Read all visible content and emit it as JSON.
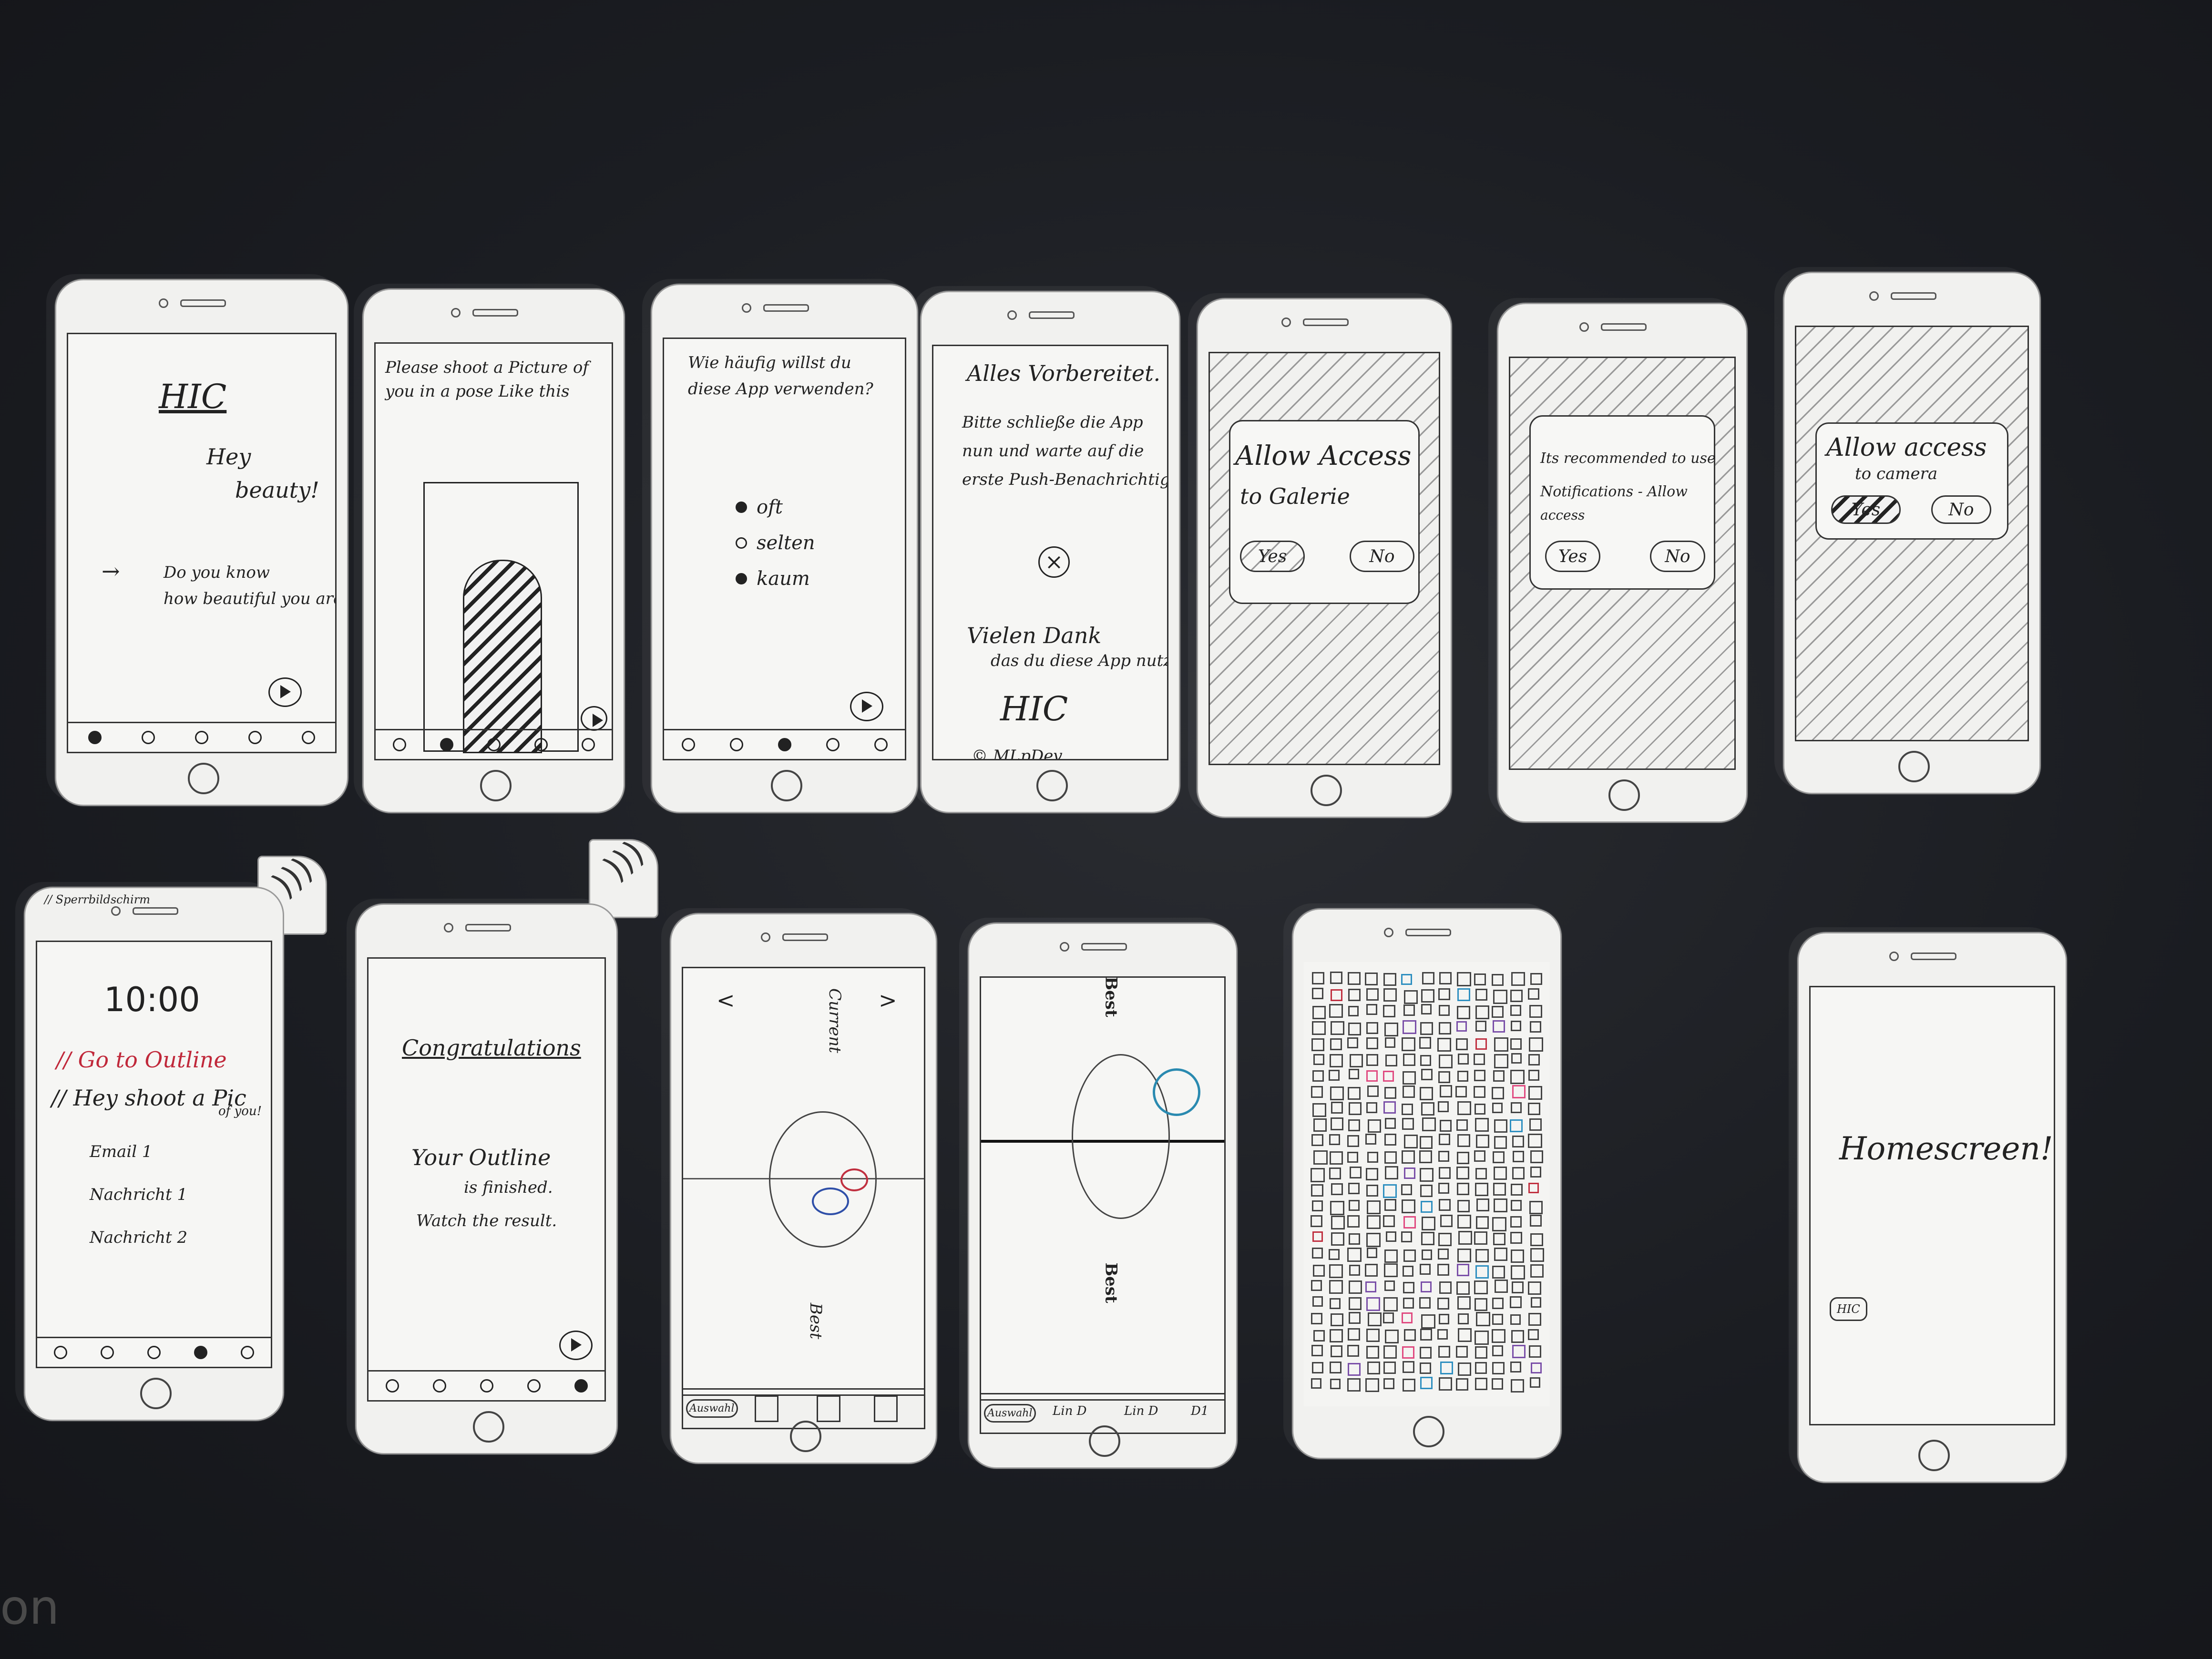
{
  "screens": {
    "s1": {
      "logo": "HIC",
      "line1": "Hey",
      "line2": "beauty!",
      "q1": "Do you know",
      "q2": "how beautiful you are?"
    },
    "s2": {
      "line1": "Please shoot a Picture of",
      "line2": "you in a pose Like this"
    },
    "s3": {
      "q1": "Wie häufig willst du",
      "q2": "diese App verwenden?",
      "options": [
        "oft",
        "selten",
        "kaum"
      ]
    },
    "s4": {
      "title": "Alles Vorbereitet.",
      "l1": "Bitte schließe die App",
      "l2": "nun und warte auf die",
      "l3": "erste Push-Benachrichtigung",
      "thanks": "Vielen Dank",
      "thanks2": "das du diese App nutzt",
      "logo": "HIC",
      "copyright": "© MLpDev"
    },
    "s5": {
      "l1": "Allow Access",
      "l2": "to Galerie",
      "yes": "Yes",
      "no": "No"
    },
    "s6": {
      "l1": "Its recommended to use",
      "l2": "Notifications - Allow",
      "l3": "access",
      "yes": "Yes",
      "no": "No"
    },
    "s7": {
      "l1": "Allow access",
      "l2": "to camera",
      "yes": "Yes",
      "no": "No"
    },
    "s8": {
      "status": "// Sperrbildschirm",
      "time": "10:00",
      "n1": "// Go to Outline",
      "n2": "// Hey shoot a Pic",
      "n2b": "of you!",
      "i1": "Email 1",
      "i2": "Nachricht 1",
      "i3": "Nachricht 2"
    },
    "s9": {
      "title": "Congratulations",
      "l1": "Your Outline",
      "l2": "is finished.",
      "l3": "Watch the result."
    },
    "s10": {
      "top": "Current",
      "bottom": "Best",
      "btn": "Auswahl"
    },
    "s11": {
      "top": "Best",
      "bottom": "Best",
      "btn": "Auswahl",
      "items": [
        "Lin D",
        "Lin D",
        "D1"
      ]
    },
    "s13": {
      "text": "Homescreen!",
      "badge": "HIC"
    }
  },
  "corner_text": "on"
}
